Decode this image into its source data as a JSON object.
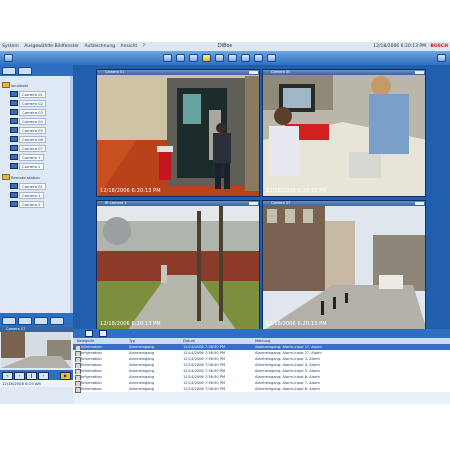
{
  "app": {
    "title": "DiBos",
    "menu": [
      "System",
      "Ausgewählte Bildfenster",
      "Aufzeichnung",
      "Ansicht",
      "?"
    ],
    "datetime": "12/18/2006 6:20:13 PM",
    "brand": "BOSCH"
  },
  "tree": {
    "items": [
      {
        "label": "localhost",
        "type": "folder"
      },
      {
        "label": "Camera 01",
        "type": "camera"
      },
      {
        "label": "Camera 02",
        "type": "camera"
      },
      {
        "label": "Camera 03",
        "type": "camera"
      },
      {
        "label": "Camera 04",
        "type": "camera"
      },
      {
        "label": "Camera 05",
        "type": "camera"
      },
      {
        "label": "Camera 06",
        "type": "camera"
      },
      {
        "label": "Camera 07",
        "type": "camera"
      },
      {
        "label": "Camera 1",
        "type": "camera"
      },
      {
        "label": "Camera 2",
        "type": "camera"
      },
      {
        "label": "Remote station",
        "type": "folder"
      },
      {
        "label": "Camera 01",
        "type": "camera"
      },
      {
        "label": "Camera 1",
        "type": "camera"
      },
      {
        "label": "Camera 2",
        "type": "camera"
      }
    ]
  },
  "cameras": [
    {
      "title": "Camera 01",
      "timestamp": "12/18/2006 6:20:13 PM"
    },
    {
      "title": "Camera 05",
      "timestamp": "12/18/2006 6:20:13 PM"
    },
    {
      "title": "IR Camera 1",
      "timestamp": "12/18/2006 6:20:13 PM"
    },
    {
      "title": "Camera 07",
      "timestamp": "12/18/2006 6:20:13 PM"
    }
  ],
  "preview": {
    "title": "Camera 07",
    "time": "12/18/2006 6:19 AM"
  },
  "alarms": {
    "columns": [
      "Kategorie",
      "Typ",
      "Datum",
      "Meldung"
    ],
    "rows": [
      {
        "category": "Information",
        "type": "Alarmeingang",
        "date": "12/14/2006 7:56:50 PM",
        "message": "Alarmeingang: Alarm-input 1?. Alarm",
        "selected": true
      },
      {
        "category": "Information",
        "type": "Alarmeingang",
        "date": "12/14/2006 7:56:50 PM",
        "message": "Alarmeingang: Alarm-input 2?. Alarm",
        "selected": false
      },
      {
        "category": "Information",
        "type": "Alarmeingang",
        "date": "12/14/2006 7:56:50 PM",
        "message": "Alarmeingang: Alarm-input 3. Alarm",
        "selected": false
      },
      {
        "category": "Information",
        "type": "Alarmeingang",
        "date": "12/14/2006 7:56:50 PM",
        "message": "Alarmeingang: Alarm-input 4. Alarm",
        "selected": false
      },
      {
        "category": "Information",
        "type": "Alarmeingang",
        "date": "12/14/2006 7:56:50 PM",
        "message": "Alarmeingang: Alarm-input 5. Alarm",
        "selected": false
      },
      {
        "category": "Information",
        "type": "Alarmeingang",
        "date": "12/14/2006 7:56:50 PM",
        "message": "Alarmeingang: Alarm-input 6. Alarm",
        "selected": false
      },
      {
        "category": "Information",
        "type": "Alarmeingang",
        "date": "12/14/2006 7:56:50 PM",
        "message": "Alarmeingang: Alarm-input 7. Alarm",
        "selected": false
      },
      {
        "category": "Information",
        "type": "Alarmeingang",
        "date": "12/14/2006 7:56:50 PM",
        "message": "Alarmeingang: Alarm-input 8. Alarm",
        "selected": false
      }
    ]
  },
  "colors": {
    "frame_blue": "#1f5fae",
    "selection_blue": "#3a6fc4",
    "brand_red": "#d01414",
    "highlight_yellow": "#f0b800"
  },
  "icons": {
    "toolbar": [
      "grid-1-icon",
      "grid-4-icon",
      "grid-9-icon",
      "layout-highlight-icon",
      "camera-icon",
      "alarm-icon",
      "record-icon",
      "playback-icon",
      "export-icon",
      "settings-icon"
    ],
    "playback": [
      "rewind-icon",
      "step-back-icon",
      "pause-icon",
      "step-forward-icon",
      "play-icon"
    ]
  }
}
